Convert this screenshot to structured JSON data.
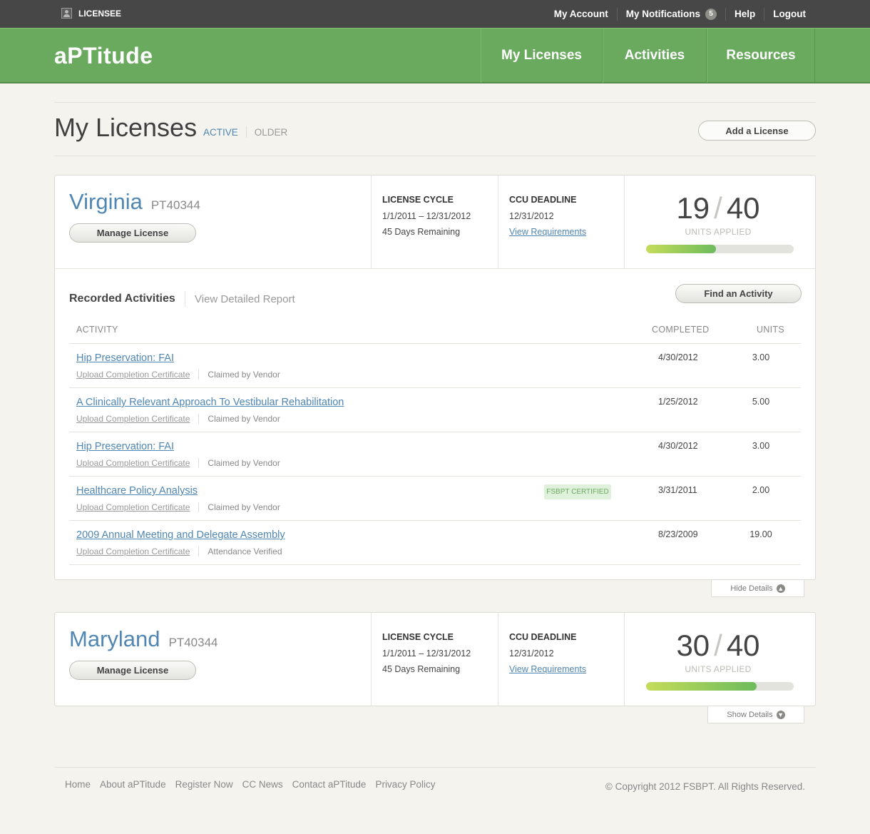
{
  "topbar": {
    "user_label": "LICENSEE",
    "links": [
      "My Account",
      "My Notifications",
      "Help",
      "Logout"
    ],
    "notifications_count": "5"
  },
  "header": {
    "logo": "aPTitude",
    "nav": [
      "My Licenses",
      "Activities",
      "Resources"
    ]
  },
  "page": {
    "title": "My Licenses",
    "tabs": [
      "ACTIVE",
      "OLDER"
    ],
    "add_license_label": "Add a License"
  },
  "licenses": [
    {
      "state": "Virginia",
      "number": "PT40344",
      "manage_label": "Manage License",
      "cycle_label": "LICENSE CYCLE",
      "cycle_dates": "1/1/2011 – 12/31/2012",
      "remaining": "45 Days Remaining",
      "ccu_label": "CCU DEADLINE",
      "ccu_date": "12/31/2012",
      "requirements_link": "View Requirements",
      "units_applied": "19",
      "units_required": "40",
      "units_label": "UNITS APPLIED",
      "progress_fraction": 0.475,
      "toggle_label": "Hide Details",
      "toggle_icon": "arrow-up-circle-icon"
    },
    {
      "state": "Maryland",
      "number": "PT40344",
      "manage_label": "Manage License",
      "cycle_label": "LICENSE CYCLE",
      "cycle_dates": "1/1/2011 – 12/31/2012",
      "remaining": "45 Days Remaining",
      "ccu_label": "CCU DEADLINE",
      "ccu_date": "12/31/2012",
      "requirements_link": "View Requirements",
      "units_applied": "30",
      "units_required": "40",
      "units_label": "UNITS APPLIED",
      "progress_fraction": 0.75,
      "toggle_label": "Show Details",
      "toggle_icon": "arrow-down-circle-icon"
    }
  ],
  "recorded": {
    "title": "Recorded Activities",
    "report_link": "View Detailed Report",
    "find_label": "Find an Activity",
    "columns": [
      "ACTIVITY",
      "COMPLETED",
      "UNITS"
    ],
    "rows": [
      {
        "title": "Hip Preservation: FAI",
        "upload": "Upload Completion Certificate",
        "status": "Claimed by Vendor",
        "completed": "4/30/2012",
        "units": "3.00",
        "badge": ""
      },
      {
        "title": "A Clinically Relevant Approach To Vestibular Rehabilitation",
        "upload": "Upload Completion Certificate",
        "status": "Claimed by Vendor",
        "completed": "1/25/2012",
        "units": "5.00",
        "badge": ""
      },
      {
        "title": "Hip Preservation: FAI",
        "upload": "Upload Completion Certificate",
        "status": "Claimed by Vendor",
        "completed": "4/30/2012",
        "units": "3.00",
        "badge": ""
      },
      {
        "title": "Healthcare Policy Analysis",
        "upload": "Upload Completion Certificate",
        "status": "Claimed by Vendor",
        "completed": "3/31/2011",
        "units": "2.00",
        "badge": "FSBPT CERTIFIED"
      },
      {
        "title": "2009 Annual Meeting and Delegate Assembly",
        "upload": "Upload Completion Certificate",
        "status": "Attendance Verified",
        "completed": "8/23/2009",
        "units": "19.00",
        "badge": ""
      }
    ]
  },
  "footer": {
    "links": [
      "Home",
      "About aPTitude",
      "Register Now",
      "CC News",
      "Contact aPTitude",
      "Privacy Policy"
    ],
    "copyright": "© Copyright 2012 FSBPT. All Rights Reserved."
  },
  "colors": {
    "header_green": "#6aaa5e",
    "topbar": "#464746",
    "link_blue": "#4f86b3",
    "progress_start": "#c5dc5a",
    "progress_end": "#6dbb5c"
  }
}
